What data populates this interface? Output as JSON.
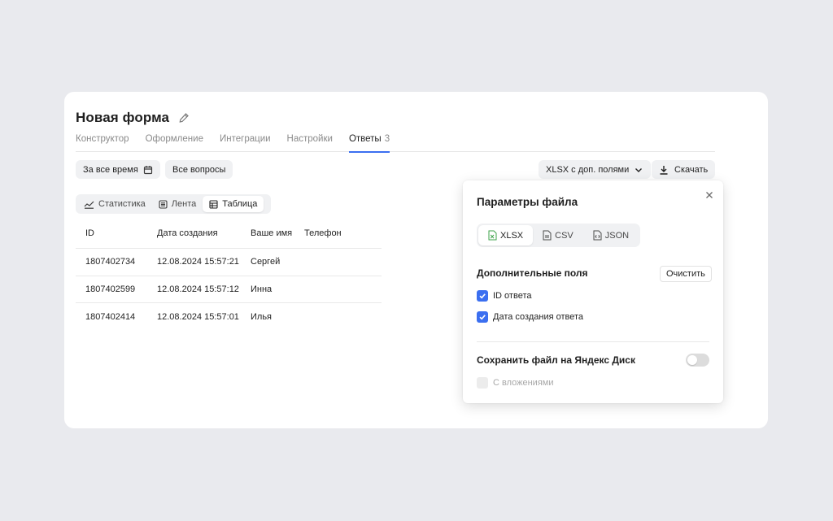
{
  "header": {
    "title": "Новая форма",
    "edit_icon": "pencil-icon"
  },
  "tabs": [
    {
      "label": "Конструктор",
      "active": false
    },
    {
      "label": "Оформление",
      "active": false
    },
    {
      "label": "Интеграции",
      "active": false
    },
    {
      "label": "Настройки",
      "active": false
    },
    {
      "label": "Ответы",
      "count": "3",
      "active": true
    }
  ],
  "filters": {
    "period_label": "За все время",
    "period_icon": "calendar-icon",
    "questions_label": "Все вопросы"
  },
  "export": {
    "format_select_value": "XLSX с доп. полями",
    "download_label": "Скачать"
  },
  "view_tabs": [
    {
      "label": "Статистика",
      "icon": "chart-icon",
      "active": false
    },
    {
      "label": "Лента",
      "icon": "feed-icon",
      "active": false
    },
    {
      "label": "Таблица",
      "icon": "table-icon",
      "active": true
    }
  ],
  "table": {
    "columns": [
      "ID",
      "Дата создания",
      "Ваше имя",
      "Телефон"
    ],
    "rows": [
      [
        "1807402734",
        "12.08.2024 15:57:21",
        "Сергей",
        ""
      ],
      [
        "1807402599",
        "12.08.2024 15:57:12",
        "Инна",
        ""
      ],
      [
        "1807402414",
        "12.08.2024 15:57:01",
        "Илья",
        ""
      ]
    ]
  },
  "popup": {
    "title": "Параметры файла",
    "formats": [
      {
        "label": "XLSX",
        "active": true
      },
      {
        "label": "CSV",
        "active": false
      },
      {
        "label": "JSON",
        "active": false
      }
    ],
    "extra_fields_title": "Дополнительные поля",
    "clear_label": "Очистить",
    "checkboxes": [
      {
        "label": "ID ответа",
        "checked": true
      },
      {
        "label": "Дата создания ответа",
        "checked": true
      }
    ],
    "save_to_disk_label": "Сохранить файл на Яндекс Диск",
    "save_to_disk_on": false,
    "attachments_label": "С вложениями",
    "attachments_disabled": true
  },
  "colors": {
    "accent": "#3b6ff0",
    "xlsx_icon": "#3da34a",
    "background": "#e9eaee"
  }
}
